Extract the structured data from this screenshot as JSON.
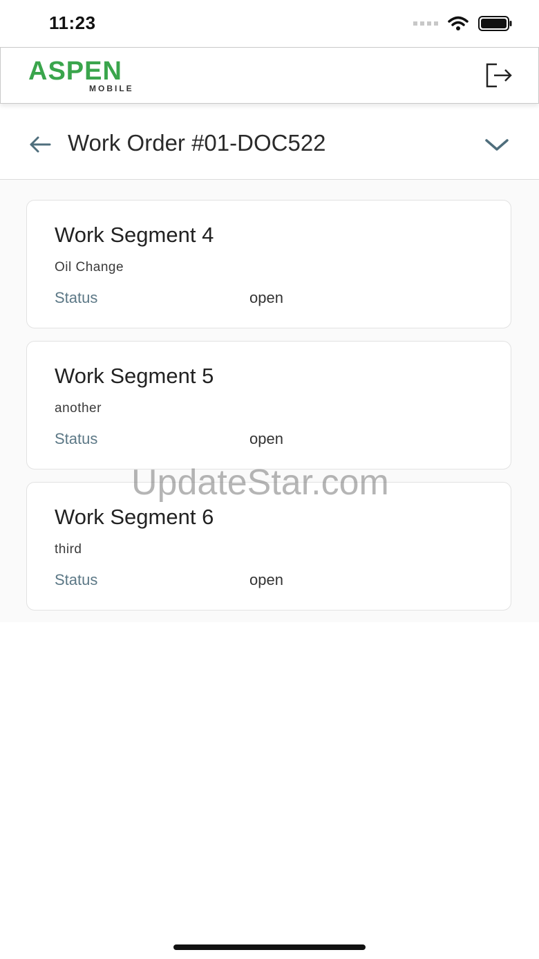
{
  "status_bar": {
    "time": "11:23",
    "icons": [
      "cellular-icon",
      "wifi-icon",
      "battery-icon"
    ]
  },
  "header": {
    "logo_main": "ASPEN",
    "logo_sub": "MOBILE",
    "logout_icon": "logout-icon",
    "brand_color": "#3aa54c"
  },
  "page": {
    "title": "Work Order #01-DOC522",
    "back_icon": "arrow-left-icon",
    "expand_icon": "chevron-down-icon"
  },
  "segments": [
    {
      "title": "Work Segment 4",
      "description": "Oil Change",
      "status_label": "Status",
      "status_value": "open"
    },
    {
      "title": "Work Segment 5",
      "description": "another",
      "status_label": "Status",
      "status_value": "open"
    },
    {
      "title": "Work Segment 6",
      "description": "third",
      "status_label": "Status",
      "status_value": "open"
    }
  ],
  "watermark": "UpdateStar.com"
}
